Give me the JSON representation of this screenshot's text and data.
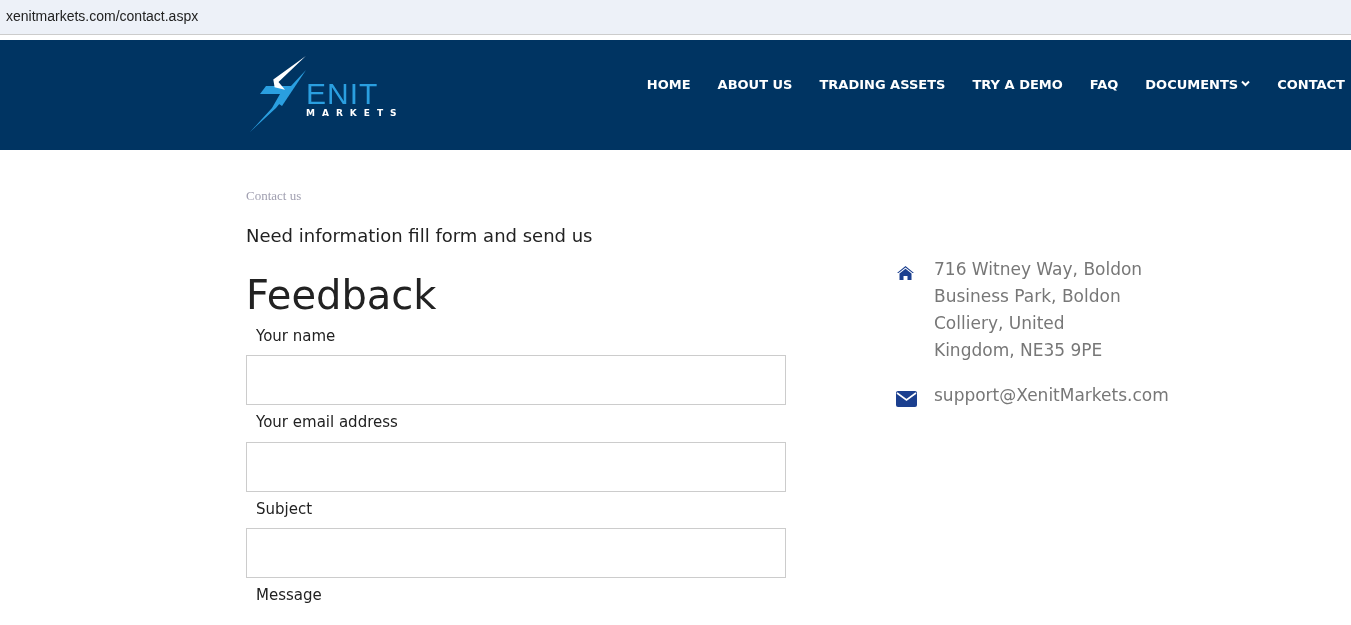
{
  "address_bar": {
    "url": "xenitmarkets.com/contact.aspx"
  },
  "header": {
    "logo": {
      "wordmark": "ENIT",
      "tagline": "MARKETS"
    },
    "nav": [
      {
        "label": "HOME",
        "dropdown": false
      },
      {
        "label": "ABOUT US",
        "dropdown": false
      },
      {
        "label": "TRADING ASSETS",
        "dropdown": false
      },
      {
        "label": "TRY A DEMO",
        "dropdown": false
      },
      {
        "label": "FAQ",
        "dropdown": false
      },
      {
        "label": "DOCUMENTS",
        "dropdown": true
      },
      {
        "label": "CONTACT",
        "dropdown": false
      }
    ]
  },
  "breadcrumb": "Contact us",
  "intro": "Need information fill form and send us",
  "form": {
    "title": "Feedback",
    "fields": [
      {
        "label": "Your name"
      },
      {
        "label": "Your email address"
      },
      {
        "label": "Subject"
      },
      {
        "label": "Message"
      }
    ]
  },
  "contact": [
    {
      "kind": "address",
      "text": "716 Witney Way, Boldon Business Park, Boldon Colliery, United Kingdom, NE35 9PE"
    },
    {
      "kind": "email",
      "text": "support@XenitMarkets.com"
    }
  ]
}
